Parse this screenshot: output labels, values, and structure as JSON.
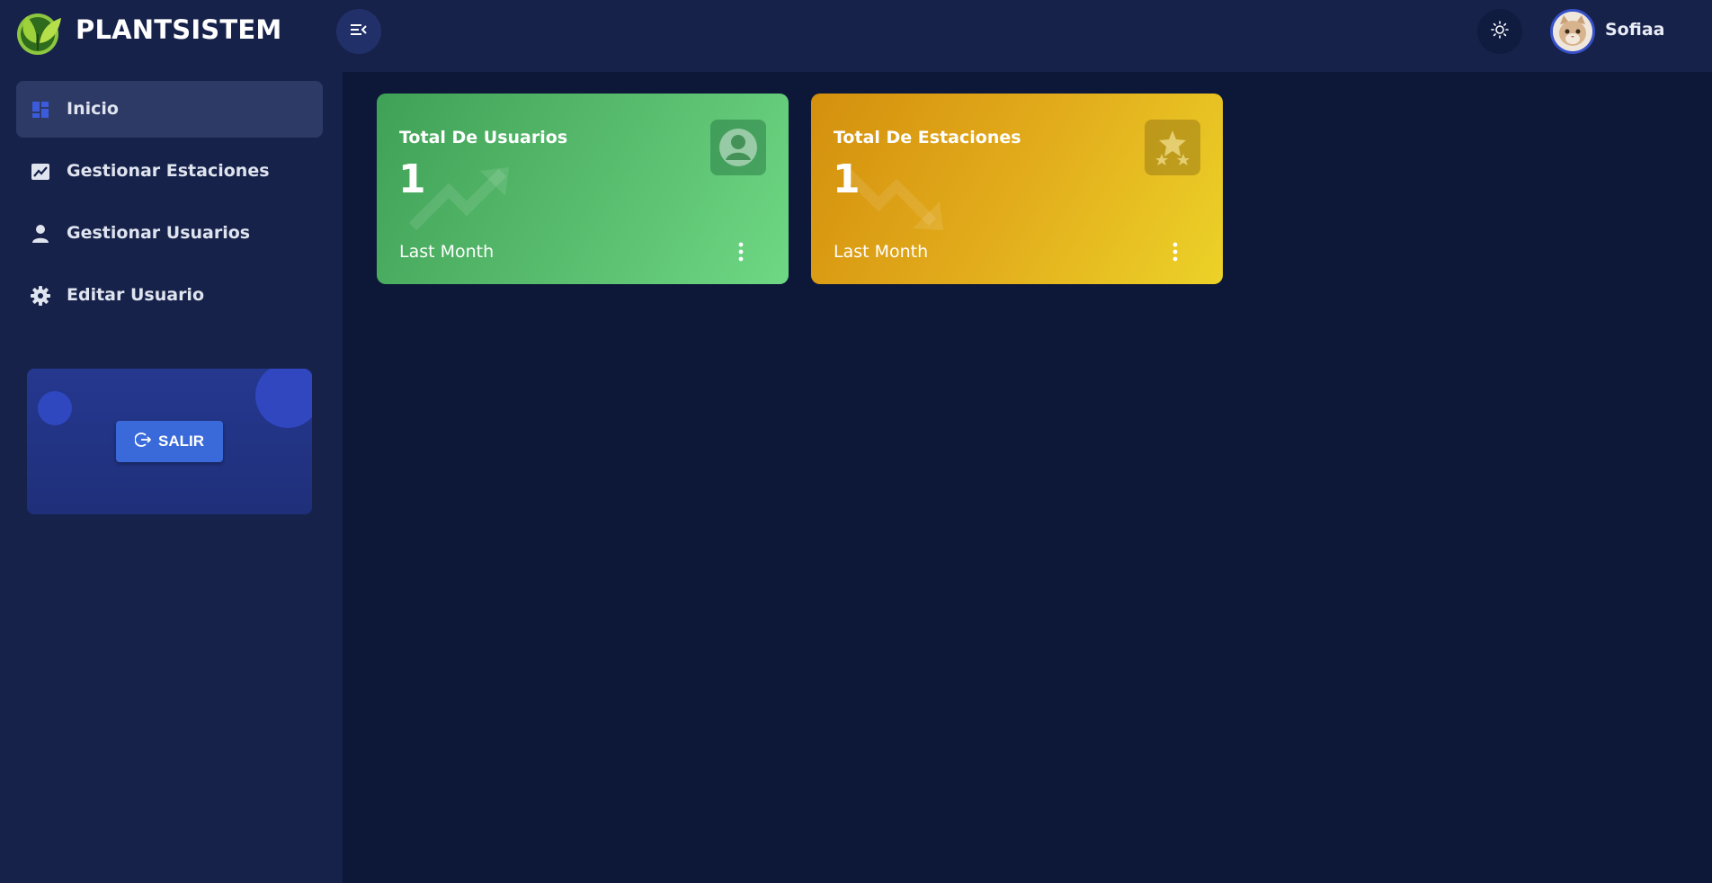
{
  "app": {
    "brand": "PLANTSISTEM",
    "user": {
      "name": "Sofiaa"
    }
  },
  "icons": {
    "logo": "leaf-logo-icon",
    "menu_toggle": "menu-collapse-icon",
    "theme": "sun-icon",
    "avatar": "cat-avatar"
  },
  "sidebar": {
    "items": [
      {
        "label": "Inicio",
        "icon": "dashboard-icon",
        "active": true
      },
      {
        "label": "Gestionar Estaciones",
        "icon": "chart-line-icon",
        "active": false
      },
      {
        "label": "Gestionar Usuarios",
        "icon": "user-icon",
        "active": false
      },
      {
        "label": "Editar Usuario",
        "icon": "gear-icon",
        "active": false
      }
    ],
    "logout": {
      "label": "SALIR",
      "icon": "logout-icon"
    }
  },
  "cards": [
    {
      "title": "Total De Usuarios",
      "value": "1",
      "footer": "Last Month",
      "icon": "user-circle-icon",
      "trend": "up",
      "color": "#4cae62"
    },
    {
      "title": "Total De Estaciones",
      "value": "1",
      "footer": "Last Month",
      "icon": "stars-icon",
      "trend": "down",
      "color": "#e2ac1c"
    }
  ],
  "colors": {
    "background": "#0d1838",
    "panel": "#17224a",
    "active_nav": "#2d3a66",
    "accent": "#3a6ad9"
  }
}
